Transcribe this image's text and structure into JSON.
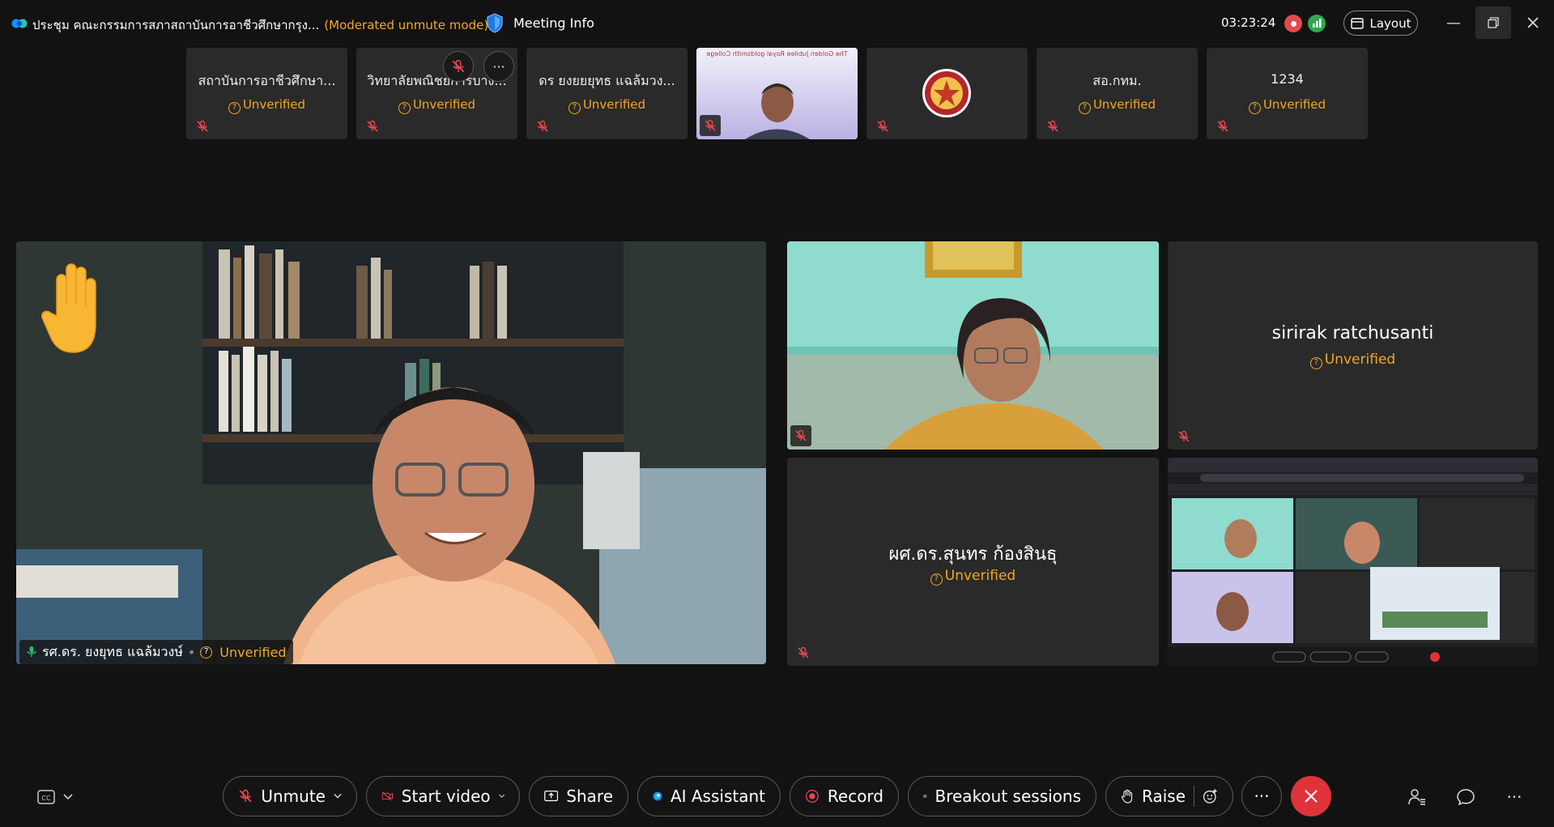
{
  "titlebar": {
    "meeting_title": "ประชุม คณะกรรมการสภาสถาบันการอาชีวศึกษากรุง...",
    "mode": "(Moderated unmute mode)",
    "meeting_info": "Meeting Info",
    "clock": "03:23:24",
    "layout_label": "Layout"
  },
  "unverified": "Unverified",
  "strip": [
    {
      "name": "สถาบันการอาชีวศึกษา...",
      "status": "Unverified"
    },
    {
      "name": "วิทยาลัยพณิชยการบาง...",
      "status": "Unverified"
    },
    {
      "name": "ดร ยงยยยุทธ แฉล้มวง...",
      "status": "Unverified"
    },
    {
      "name": "",
      "status": ""
    },
    {
      "name": "",
      "status": ""
    },
    {
      "name": "สอ.กทม.",
      "status": "Unverified"
    },
    {
      "name": "1234",
      "status": "Unverified"
    }
  ],
  "strip_video_banner": "The Golden Jubilee Royal goldsmith College",
  "speaker": {
    "name": "รศ.ดร. ยงยุทธ แฉล้มวงษ์",
    "status": "Unverified"
  },
  "tiles": [
    {
      "name": "sirirak ratchusanti",
      "status": "Unverified"
    },
    {
      "name": "ผศ.ดร.สุนทร ก้องสินธุ",
      "status": "Unverified"
    }
  ],
  "toolbar": {
    "unmute": "Unmute",
    "start_video": "Start video",
    "share": "Share",
    "ai_assistant": "AI Assistant",
    "record": "Record",
    "breakout": "Breakout sessions",
    "raise": "Raise"
  },
  "colors": {
    "background": "#121212",
    "tile": "#2a2a2a",
    "unverified": "#f5a623",
    "leave": "#e0323a",
    "record": "#e5484d"
  }
}
